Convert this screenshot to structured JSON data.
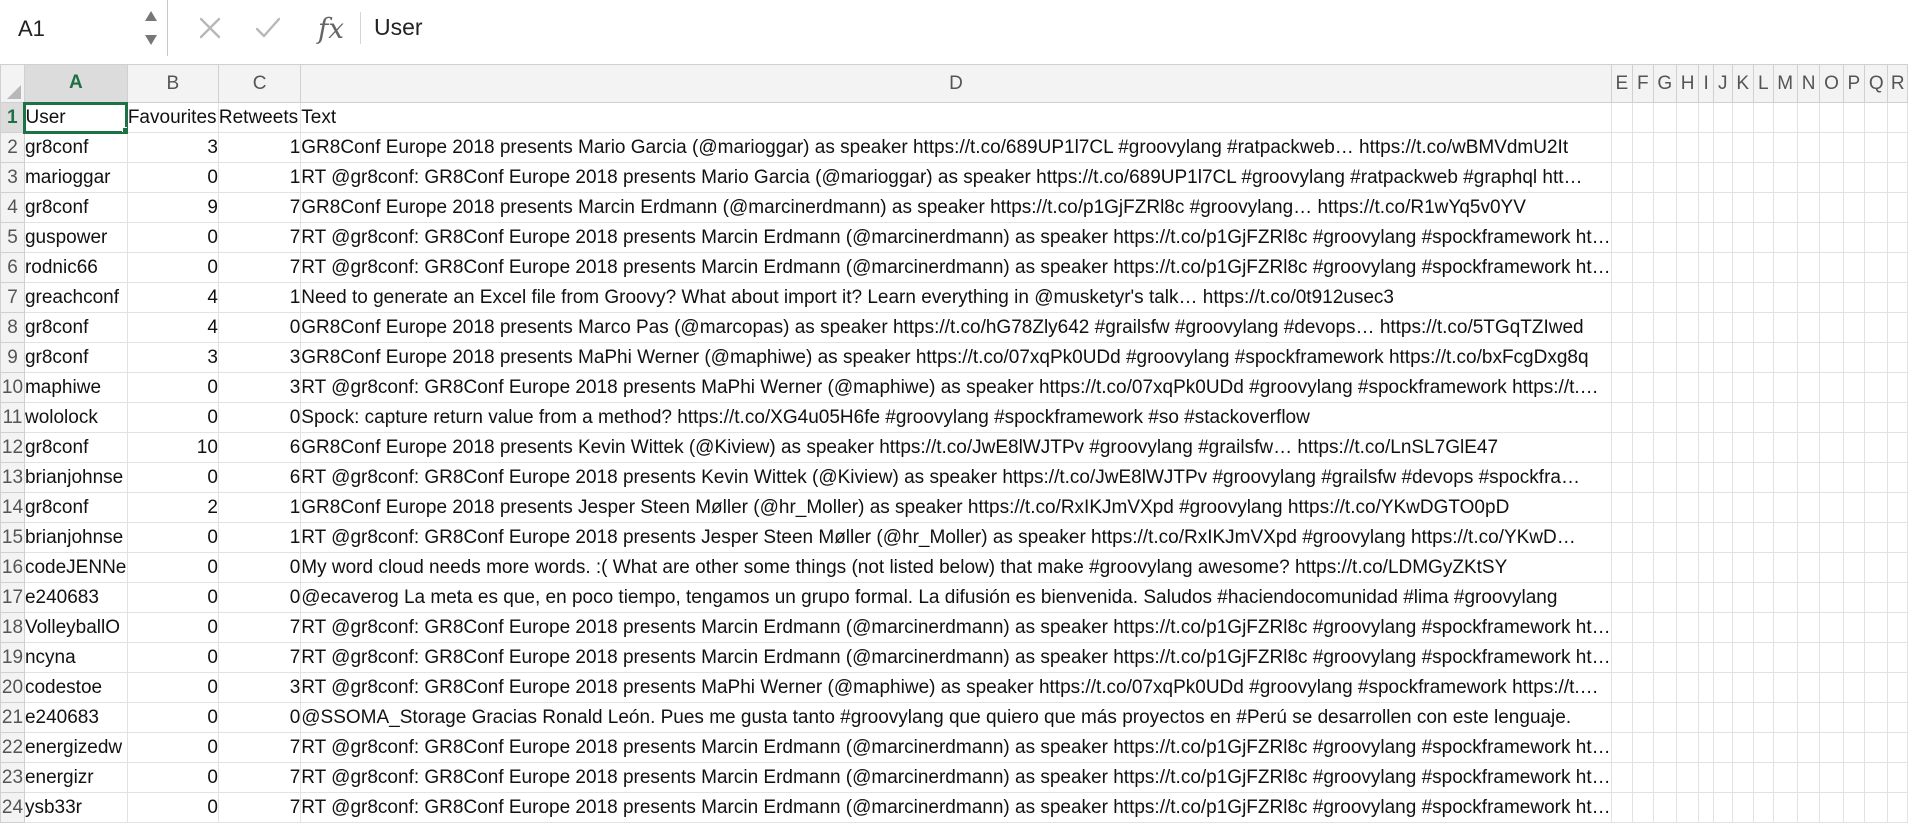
{
  "formula_bar": {
    "cell_ref": "A1",
    "content": "User",
    "cancel_icon": "close-icon",
    "confirm_icon": "check-icon",
    "fx_label": "fx"
  },
  "columns": [
    "A",
    "B",
    "C",
    "D",
    "E",
    "F",
    "G",
    "H",
    "I",
    "J",
    "K",
    "L",
    "M",
    "N",
    "O",
    "P",
    "Q",
    "R"
  ],
  "active_column": "A",
  "active_row": 1,
  "accent_color": "#1e7145",
  "rows": [
    {
      "n": "1",
      "a": "User",
      "b": "Favourites",
      "c": "Retweets",
      "d": "Text"
    },
    {
      "n": "2",
      "a": "gr8conf",
      "b": "3",
      "c": "1",
      "d": "GR8Conf Europe 2018 presents Mario Garcia (@marioggar) as speaker https://t.co/689UP1l7CL #groovylang #ratpackweb… https://t.co/wBMVdmU2It"
    },
    {
      "n": "3",
      "a": "marioggar",
      "b": "0",
      "c": "1",
      "d": "RT @gr8conf: GR8Conf Europe 2018 presents Mario Garcia (@marioggar) as speaker https://t.co/689UP1l7CL #groovylang #ratpackweb #graphql htt…"
    },
    {
      "n": "4",
      "a": "gr8conf",
      "b": "9",
      "c": "7",
      "d": "GR8Conf Europe 2018 presents Marcin Erdmann (@marcinerdmann) as speaker https://t.co/p1GjFZRl8c #groovylang… https://t.co/R1wYq5v0YV"
    },
    {
      "n": "5",
      "a": "guspower",
      "b": "0",
      "c": "7",
      "d": "RT @gr8conf: GR8Conf Europe 2018 presents Marcin Erdmann (@marcinerdmann) as speaker https://t.co/p1GjFZRl8c #groovylang #spockframework ht…"
    },
    {
      "n": "6",
      "a": "rodnic66",
      "b": "0",
      "c": "7",
      "d": "RT @gr8conf: GR8Conf Europe 2018 presents Marcin Erdmann (@marcinerdmann) as speaker https://t.co/p1GjFZRl8c #groovylang #spockframework ht…"
    },
    {
      "n": "7",
      "a": "greachconf",
      "b": "4",
      "c": "1",
      "d": "Need to generate an Excel file from Groovy? What about import it? Learn everything in @musketyr's talk… https://t.co/0t912usec3"
    },
    {
      "n": "8",
      "a": "gr8conf",
      "b": "4",
      "c": "0",
      "d": "GR8Conf Europe 2018 presents Marco Pas (@marcopas) as speaker https://t.co/hG78Zly642 #grailsfw #groovylang #devops… https://t.co/5TGqTZIwed"
    },
    {
      "n": "9",
      "a": "gr8conf",
      "b": "3",
      "c": "3",
      "d": "GR8Conf Europe 2018 presents MaPhi Werner (@maphiwe) as speaker https://t.co/07xqPk0UDd #groovylang #spockframework https://t.co/bxFcgDxg8q"
    },
    {
      "n": "10",
      "a": "maphiwe",
      "b": "0",
      "c": "3",
      "d": "RT @gr8conf: GR8Conf Europe 2018 presents MaPhi Werner (@maphiwe) as speaker https://t.co/07xqPk0UDd #groovylang #spockframework https://t.…"
    },
    {
      "n": "11",
      "a": "wololock",
      "b": "0",
      "c": "0",
      "d": "Spock: capture return value from a method? https://t.co/XG4u05H6fe #groovylang #spockframework #so #stackoverflow"
    },
    {
      "n": "12",
      "a": "gr8conf",
      "b": "10",
      "c": "6",
      "d": "GR8Conf Europe 2018 presents Kevin Wittek (@Kiview) as speaker https://t.co/JwE8lWJTPv #groovylang #grailsfw… https://t.co/LnSL7GlE47"
    },
    {
      "n": "13",
      "a": "brianjohnse",
      "b": "0",
      "c": "6",
      "d": "RT @gr8conf: GR8Conf Europe 2018 presents Kevin Wittek (@Kiview) as speaker https://t.co/JwE8lWJTPv #groovylang #grailsfw #devops #spockfra…"
    },
    {
      "n": "14",
      "a": "gr8conf",
      "b": "2",
      "c": "1",
      "d": "GR8Conf Europe 2018 presents Jesper Steen Møller (@hr_Moller) as speaker https://t.co/RxIKJmVXpd #groovylang https://t.co/YKwDGTO0pD"
    },
    {
      "n": "15",
      "a": "brianjohnse",
      "b": "0",
      "c": "1",
      "d": "RT @gr8conf: GR8Conf Europe 2018 presents Jesper Steen Møller (@hr_Moller) as speaker https://t.co/RxIKJmVXpd #groovylang https://t.co/YKwD…"
    },
    {
      "n": "16",
      "a": "codeJENNe",
      "b": "0",
      "c": "0",
      "d": "My word cloud needs more words. :( What are other some things (not listed below) that make #groovylang awesome? https://t.co/LDMGyZKtSY"
    },
    {
      "n": "17",
      "a": "e240683",
      "b": "0",
      "c": "0",
      "d": "@ecaverog La meta es que, en poco tiempo, tengamos un grupo formal. La difusión es bienvenida. Saludos #haciendocomunidad #lima #groovylang"
    },
    {
      "n": "18",
      "a": "VolleyballO",
      "b": "0",
      "c": "7",
      "d": "RT @gr8conf: GR8Conf Europe 2018 presents Marcin Erdmann (@marcinerdmann) as speaker https://t.co/p1GjFZRl8c #groovylang #spockframework ht…"
    },
    {
      "n": "19",
      "a": "ncyna",
      "b": "0",
      "c": "7",
      "d": "RT @gr8conf: GR8Conf Europe 2018 presents Marcin Erdmann (@marcinerdmann) as speaker https://t.co/p1GjFZRl8c #groovylang #spockframework ht…"
    },
    {
      "n": "20",
      "a": "codestoe",
      "b": "0",
      "c": "3",
      "d": "RT @gr8conf: GR8Conf Europe 2018 presents MaPhi Werner (@maphiwe) as speaker https://t.co/07xqPk0UDd #groovylang #spockframework https://t.…"
    },
    {
      "n": "21",
      "a": "e240683",
      "b": "0",
      "c": "0",
      "d": "@SSOMA_Storage Gracias Ronald León. Pues me gusta tanto #groovylang que quiero que más proyectos en #Perú se desarrollen con este lenguaje."
    },
    {
      "n": "22",
      "a": "energizedw",
      "b": "0",
      "c": "7",
      "d": "RT @gr8conf: GR8Conf Europe 2018 presents Marcin Erdmann (@marcinerdmann) as speaker https://t.co/p1GjFZRl8c #groovylang #spockframework ht…"
    },
    {
      "n": "23",
      "a": "energizr",
      "b": "0",
      "c": "7",
      "d": "RT @gr8conf: GR8Conf Europe 2018 presents Marcin Erdmann (@marcinerdmann) as speaker https://t.co/p1GjFZRl8c #groovylang #spockframework ht…"
    },
    {
      "n": "24",
      "a": "ysb33r",
      "b": "0",
      "c": "7",
      "d": "RT @gr8conf: GR8Conf Europe 2018 presents Marcin Erdmann (@marcinerdmann) as speaker https://t.co/p1GjFZRl8c #groovylang #spockframework ht…"
    }
  ]
}
